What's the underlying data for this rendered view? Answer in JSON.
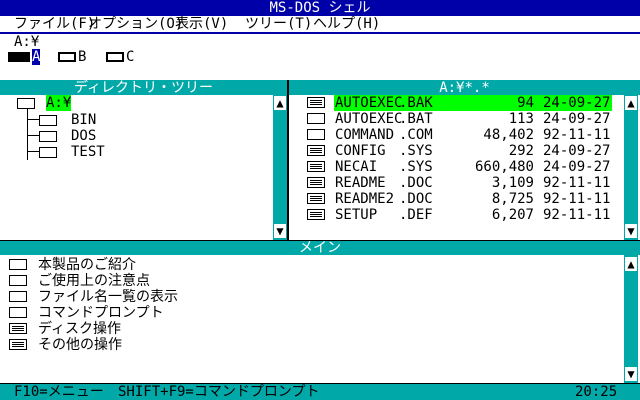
{
  "window": {
    "title": "MS-DOS シェル"
  },
  "menubar": [
    "ファイル(F)",
    "オプション(O)",
    "表示(V)",
    "ツリー(T)",
    "ヘルプ(H)"
  ],
  "path": "A:¥",
  "drives": [
    {
      "letter": "A",
      "selected": true
    },
    {
      "letter": "B",
      "selected": false
    },
    {
      "letter": "C",
      "selected": false
    }
  ],
  "tree": {
    "header": "ディレクトリ・ツリー",
    "root": "A:¥",
    "dirs": [
      "BIN",
      "DOS",
      "TEST"
    ]
  },
  "files": {
    "header": "A:¥*.*",
    "items": [
      {
        "name": "AUTOEXEC",
        "ext": ".BAK",
        "size": "94",
        "date": "24-09-27",
        "icon": "data",
        "selected": true
      },
      {
        "name": "AUTOEXEC",
        "ext": ".BAT",
        "size": "113",
        "date": "24-09-27",
        "icon": "prog",
        "selected": false
      },
      {
        "name": "COMMAND",
        "ext": ".COM",
        "size": "48,402",
        "date": "92-11-11",
        "icon": "prog",
        "selected": false
      },
      {
        "name": "CONFIG",
        "ext": ".SYS",
        "size": "292",
        "date": "24-09-27",
        "icon": "data",
        "selected": false
      },
      {
        "name": "NECAI",
        "ext": ".SYS",
        "size": "660,480",
        "date": "24-09-27",
        "icon": "data",
        "selected": false
      },
      {
        "name": "README",
        "ext": ".DOC",
        "size": "3,109",
        "date": "92-11-11",
        "icon": "data",
        "selected": false
      },
      {
        "name": "README2",
        "ext": ".DOC",
        "size": "8,725",
        "date": "92-11-11",
        "icon": "data",
        "selected": false
      },
      {
        "name": "SETUP",
        "ext": ".DEF",
        "size": "6,207",
        "date": "92-11-11",
        "icon": "data",
        "selected": false
      }
    ]
  },
  "main": {
    "header": "メイン",
    "items": [
      {
        "label": "本製品のご紹介",
        "icon": "prog"
      },
      {
        "label": "ご使用上の注意点",
        "icon": "prog"
      },
      {
        "label": "ファイル名一覧の表示",
        "icon": "prog"
      },
      {
        "label": "コマンドプロンプト",
        "icon": "prog"
      },
      {
        "label": "ディスク操作",
        "icon": "group"
      },
      {
        "label": "その他の操作",
        "icon": "group"
      }
    ]
  },
  "status": {
    "f10": "F10=メニュー",
    "shift_f9": "SHIFT+F9=コマンドプロンプト",
    "time": "20:25"
  },
  "colors": {
    "bar": "#0000a8",
    "panel_header": "#00a8a8",
    "highlight": "#00ff00"
  },
  "icons": {
    "scroll_up": "▲",
    "scroll_down": "▼"
  }
}
